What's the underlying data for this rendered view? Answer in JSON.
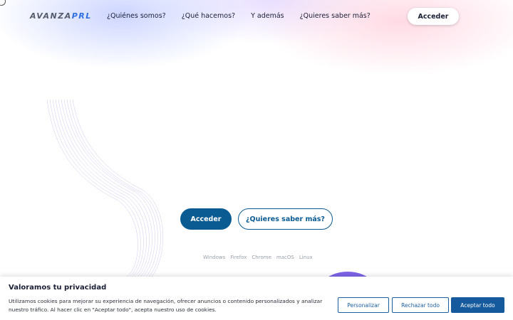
{
  "brand": {
    "logo_part1": "AVANZA",
    "logo_part2": "PRL"
  },
  "nav": {
    "items": [
      {
        "label": "¿Quiénes somos?"
      },
      {
        "label": "¿Qué hacemos?"
      },
      {
        "label": "Y además"
      },
      {
        "label": "¿Quieres saber más?"
      }
    ],
    "login_label": "Acceder"
  },
  "hero": {
    "primary_label": "Acceder",
    "secondary_label": "¿Quieres saber más?",
    "platforms": [
      "Windows",
      "Firefox",
      "Chrome",
      "macOS",
      "Linux"
    ]
  },
  "cookies": {
    "title": "Valoramos tu privacidad",
    "text": "Utilizamos cookies para mejorar su experiencia de navegación, ofrecer anuncios o contenido personalizados y analizar nuestro tráfico. Al hacer clic en \"Aceptar todo\", acepta nuestro uso de cookies.",
    "customize_label": "Personalizar",
    "reject_label": "Rechazar todo",
    "accept_label": "Aceptar todo"
  },
  "colors": {
    "primary": "#0b5b93",
    "accent_blue": "#2e6fe0",
    "purple": "#7d63e8"
  }
}
